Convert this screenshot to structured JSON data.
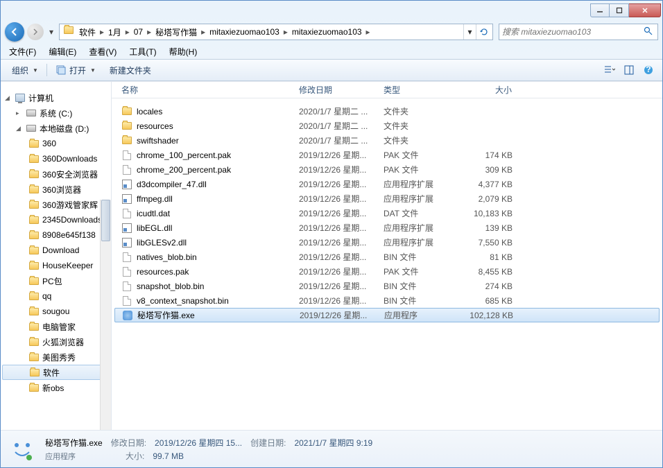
{
  "window": {
    "title": ""
  },
  "nav": {
    "breadcrumbs": [
      "软件",
      "1月",
      "07",
      "秘塔写作猫",
      "mitaxiezuomao103",
      "mitaxiezuomao103"
    ],
    "search_placeholder": "搜索 mitaxiezuomao103"
  },
  "menubar": {
    "file": "文件(F)",
    "edit": "编辑(E)",
    "view": "查看(V)",
    "tools": "工具(T)",
    "help": "帮助(H)"
  },
  "toolbar": {
    "organize": "组织",
    "open": "打开",
    "newfolder": "新建文件夹"
  },
  "tree": {
    "computer": "计算机",
    "drive_c": "系统 (C:)",
    "drive_d": "本地磁盘 (D:)",
    "folders": [
      "360",
      "360Downloads",
      "360安全浏览器",
      "360浏览器",
      "360游戏管家辉",
      "2345Downloads",
      "8908e645f138",
      "Download",
      "HouseKeeper",
      "PC包",
      "qq",
      "sougou",
      "电脑管家",
      "火狐浏览器",
      "美图秀秀",
      "软件",
      "新obs"
    ],
    "selected": "软件"
  },
  "columns": {
    "name": "名称",
    "date": "修改日期",
    "type": "类型",
    "size": "大小"
  },
  "files": [
    {
      "icon": "folder",
      "name": "locales",
      "date": "2020/1/7 星期二 ...",
      "type": "文件夹",
      "size": ""
    },
    {
      "icon": "folder",
      "name": "resources",
      "date": "2020/1/7 星期二 ...",
      "type": "文件夹",
      "size": ""
    },
    {
      "icon": "folder",
      "name": "swiftshader",
      "date": "2020/1/7 星期二 ...",
      "type": "文件夹",
      "size": ""
    },
    {
      "icon": "page",
      "name": "chrome_100_percent.pak",
      "date": "2019/12/26 星期...",
      "type": "PAK 文件",
      "size": "174 KB"
    },
    {
      "icon": "page",
      "name": "chrome_200_percent.pak",
      "date": "2019/12/26 星期...",
      "type": "PAK 文件",
      "size": "309 KB"
    },
    {
      "icon": "dll",
      "name": "d3dcompiler_47.dll",
      "date": "2019/12/26 星期...",
      "type": "应用程序扩展",
      "size": "4,377 KB"
    },
    {
      "icon": "dll",
      "name": "ffmpeg.dll",
      "date": "2019/12/26 星期...",
      "type": "应用程序扩展",
      "size": "2,079 KB"
    },
    {
      "icon": "page",
      "name": "icudtl.dat",
      "date": "2019/12/26 星期...",
      "type": "DAT 文件",
      "size": "10,183 KB"
    },
    {
      "icon": "dll",
      "name": "libEGL.dll",
      "date": "2019/12/26 星期...",
      "type": "应用程序扩展",
      "size": "139 KB"
    },
    {
      "icon": "dll",
      "name": "libGLESv2.dll",
      "date": "2019/12/26 星期...",
      "type": "应用程序扩展",
      "size": "7,550 KB"
    },
    {
      "icon": "page",
      "name": "natives_blob.bin",
      "date": "2019/12/26 星期...",
      "type": "BIN 文件",
      "size": "81 KB"
    },
    {
      "icon": "page",
      "name": "resources.pak",
      "date": "2019/12/26 星期...",
      "type": "PAK 文件",
      "size": "8,455 KB"
    },
    {
      "icon": "page",
      "name": "snapshot_blob.bin",
      "date": "2019/12/26 星期...",
      "type": "BIN 文件",
      "size": "274 KB"
    },
    {
      "icon": "page",
      "name": "v8_context_snapshot.bin",
      "date": "2019/12/26 星期...",
      "type": "BIN 文件",
      "size": "685 KB"
    },
    {
      "icon": "exe",
      "name": "秘塔写作猫.exe",
      "date": "2019/12/26 星期...",
      "type": "应用程序",
      "size": "102,128 KB",
      "selected": true
    }
  ],
  "details": {
    "filename": "秘塔写作猫.exe",
    "filetype": "应用程序",
    "mod_label": "修改日期:",
    "mod_value": "2019/12/26 星期四 15...",
    "create_label": "创建日期:",
    "create_value": "2021/1/7 星期四 9:19",
    "size_label": "大小:",
    "size_value": "99.7 MB"
  }
}
